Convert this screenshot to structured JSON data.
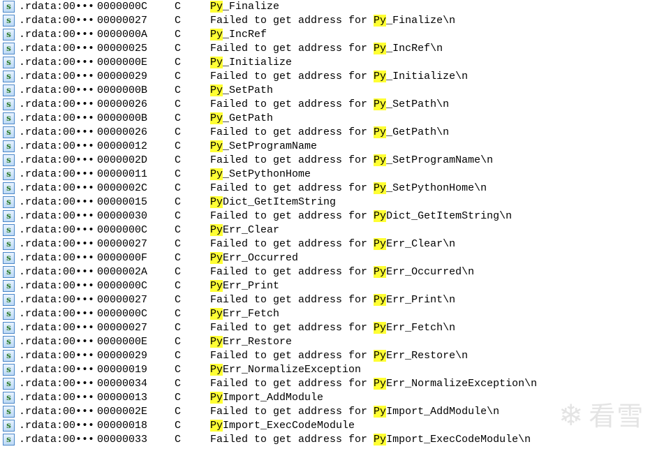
{
  "window": "IDA Strings window",
  "colors": {
    "highlight": "#ffff33",
    "icon_border": "#4a86c8"
  },
  "search_highlight": "Py",
  "watermark": "看雪",
  "rows": [
    {
      "address": ".rdata:00•••",
      "length": "0000000C",
      "type": "C",
      "prefix": "",
      "match": "Py",
      "rest": "_Finalize"
    },
    {
      "address": ".rdata:00•••",
      "length": "00000027",
      "type": "C",
      "prefix": "Failed to get address for ",
      "match": "Py",
      "rest": "_Finalize\\n"
    },
    {
      "address": ".rdata:00•••",
      "length": "0000000A",
      "type": "C",
      "prefix": "",
      "match": "Py",
      "rest": "_IncRef"
    },
    {
      "address": ".rdata:00•••",
      "length": "00000025",
      "type": "C",
      "prefix": "Failed to get address for ",
      "match": "Py",
      "rest": "_IncRef\\n"
    },
    {
      "address": ".rdata:00•••",
      "length": "0000000E",
      "type": "C",
      "prefix": "",
      "match": "Py",
      "rest": "_Initialize"
    },
    {
      "address": ".rdata:00•••",
      "length": "00000029",
      "type": "C",
      "prefix": "Failed to get address for ",
      "match": "Py",
      "rest": "_Initialize\\n"
    },
    {
      "address": ".rdata:00•••",
      "length": "0000000B",
      "type": "C",
      "prefix": "",
      "match": "Py",
      "rest": "_SetPath"
    },
    {
      "address": ".rdata:00•••",
      "length": "00000026",
      "type": "C",
      "prefix": "Failed to get address for ",
      "match": "Py",
      "rest": "_SetPath\\n"
    },
    {
      "address": ".rdata:00•••",
      "length": "0000000B",
      "type": "C",
      "prefix": "",
      "match": "Py",
      "rest": "_GetPath"
    },
    {
      "address": ".rdata:00•••",
      "length": "00000026",
      "type": "C",
      "prefix": "Failed to get address for ",
      "match": "Py",
      "rest": "_GetPath\\n"
    },
    {
      "address": ".rdata:00•••",
      "length": "00000012",
      "type": "C",
      "prefix": "",
      "match": "Py",
      "rest": "_SetProgramName"
    },
    {
      "address": ".rdata:00•••",
      "length": "0000002D",
      "type": "C",
      "prefix": "Failed to get address for ",
      "match": "Py",
      "rest": "_SetProgramName\\n"
    },
    {
      "address": ".rdata:00•••",
      "length": "00000011",
      "type": "C",
      "prefix": "",
      "match": "Py",
      "rest": "_SetPythonHome"
    },
    {
      "address": ".rdata:00•••",
      "length": "0000002C",
      "type": "C",
      "prefix": "Failed to get address for ",
      "match": "Py",
      "rest": "_SetPythonHome\\n"
    },
    {
      "address": ".rdata:00•••",
      "length": "00000015",
      "type": "C",
      "prefix": "",
      "match": "Py",
      "rest": "Dict_GetItemString"
    },
    {
      "address": ".rdata:00•••",
      "length": "00000030",
      "type": "C",
      "prefix": "Failed to get address for ",
      "match": "Py",
      "rest": "Dict_GetItemString\\n"
    },
    {
      "address": ".rdata:00•••",
      "length": "0000000C",
      "type": "C",
      "prefix": "",
      "match": "Py",
      "rest": "Err_Clear"
    },
    {
      "address": ".rdata:00•••",
      "length": "00000027",
      "type": "C",
      "prefix": "Failed to get address for ",
      "match": "Py",
      "rest": "Err_Clear\\n"
    },
    {
      "address": ".rdata:00•••",
      "length": "0000000F",
      "type": "C",
      "prefix": "",
      "match": "Py",
      "rest": "Err_Occurred"
    },
    {
      "address": ".rdata:00•••",
      "length": "0000002A",
      "type": "C",
      "prefix": "Failed to get address for ",
      "match": "Py",
      "rest": "Err_Occurred\\n"
    },
    {
      "address": ".rdata:00•••",
      "length": "0000000C",
      "type": "C",
      "prefix": "",
      "match": "Py",
      "rest": "Err_Print"
    },
    {
      "address": ".rdata:00•••",
      "length": "00000027",
      "type": "C",
      "prefix": "Failed to get address for ",
      "match": "Py",
      "rest": "Err_Print\\n"
    },
    {
      "address": ".rdata:00•••",
      "length": "0000000C",
      "type": "C",
      "prefix": "",
      "match": "Py",
      "rest": "Err_Fetch"
    },
    {
      "address": ".rdata:00•••",
      "length": "00000027",
      "type": "C",
      "prefix": "Failed to get address for ",
      "match": "Py",
      "rest": "Err_Fetch\\n"
    },
    {
      "address": ".rdata:00•••",
      "length": "0000000E",
      "type": "C",
      "prefix": "",
      "match": "Py",
      "rest": "Err_Restore"
    },
    {
      "address": ".rdata:00•••",
      "length": "00000029",
      "type": "C",
      "prefix": "Failed to get address for ",
      "match": "Py",
      "rest": "Err_Restore\\n"
    },
    {
      "address": ".rdata:00•••",
      "length": "00000019",
      "type": "C",
      "prefix": "",
      "match": "Py",
      "rest": "Err_NormalizeException"
    },
    {
      "address": ".rdata:00•••",
      "length": "00000034",
      "type": "C",
      "prefix": "Failed to get address for ",
      "match": "Py",
      "rest": "Err_NormalizeException\\n"
    },
    {
      "address": ".rdata:00•••",
      "length": "00000013",
      "type": "C",
      "prefix": "",
      "match": "Py",
      "rest": "Import_AddModule"
    },
    {
      "address": ".rdata:00•••",
      "length": "0000002E",
      "type": "C",
      "prefix": "Failed to get address for ",
      "match": "Py",
      "rest": "Import_AddModule\\n"
    },
    {
      "address": ".rdata:00•••",
      "length": "00000018",
      "type": "C",
      "prefix": "",
      "match": "Py",
      "rest": "Import_ExecCodeModule"
    },
    {
      "address": ".rdata:00•••",
      "length": "00000033",
      "type": "C",
      "prefix": "Failed to get address for ",
      "match": "Py",
      "rest": "Import_ExecCodeModule\\n"
    }
  ]
}
